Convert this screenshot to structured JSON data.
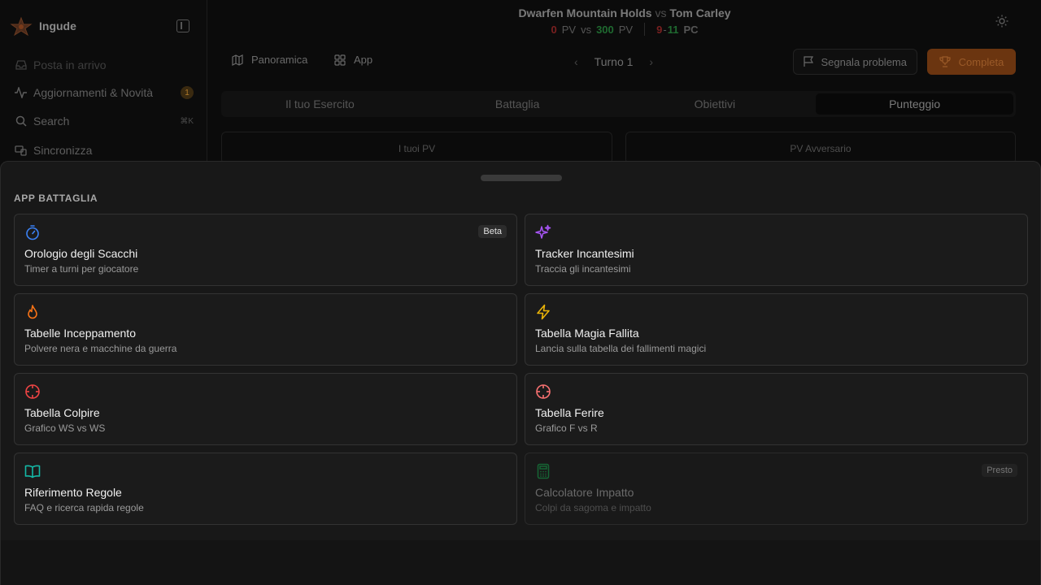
{
  "sidebar": {
    "brand_name": "Ingude",
    "items": [
      {
        "label": "Posta in arrivo",
        "icon": "inbox-icon"
      },
      {
        "label": "Aggiornamenti & Novità",
        "icon": "activity-icon",
        "badge": "1"
      },
      {
        "label": "Search",
        "icon": "search-icon",
        "shortcut": "⌘K"
      },
      {
        "label": "Sincronizza",
        "icon": "sync-icon"
      }
    ]
  },
  "header": {
    "player1": "Dwarfen Mountain Holds",
    "vs": "vs",
    "player2": "Tom Carley",
    "score": {
      "p1_pv": "0",
      "pv_label": "PV",
      "vs": "vs",
      "p2_pv": "300",
      "pc_left": "9",
      "pc_dash": "-",
      "pc_right": "11",
      "pc_label": "PC"
    }
  },
  "toolbar": {
    "overview_label": "Panoramica",
    "apps_label": "App",
    "turn_label": "Turno 1",
    "report_label": "Segnala problema",
    "complete_label": "Completa"
  },
  "tabs": [
    {
      "label": "Il tuo Esercito"
    },
    {
      "label": "Battaglia"
    },
    {
      "label": "Obiettivi"
    },
    {
      "label": "Punteggio",
      "active": true
    }
  ],
  "pv_boxes": {
    "mine": "I tuoi PV",
    "opponent": "PV Avversario"
  },
  "sheet": {
    "title": "APP BATTAGLIA",
    "cards": [
      {
        "title": "Orologio degli Scacchi",
        "desc": "Timer a turni per giocatore",
        "tag": "Beta",
        "icon": "stopwatch-icon",
        "color": "#3b82f6"
      },
      {
        "title": "Tracker Incantesimi",
        "desc": "Traccia gli incantesimi",
        "icon": "sparkles-icon",
        "color": "#a855f7"
      },
      {
        "title": "Tabelle Inceppamento",
        "desc": "Polvere nera e macchine da guerra",
        "icon": "flame-icon",
        "color": "#f97316"
      },
      {
        "title": "Tabella Magia Fallita",
        "desc": "Lancia sulla tabella dei fallimenti magici",
        "icon": "zap-icon",
        "color": "#eab308"
      },
      {
        "title": "Tabella Colpire",
        "desc": "Grafico WS vs WS",
        "icon": "crosshair-icon",
        "color": "#ef4444"
      },
      {
        "title": "Tabella Ferire",
        "desc": "Grafico F vs R",
        "icon": "crosshair-icon",
        "color": "#f87171"
      },
      {
        "title": "Riferimento Regole",
        "desc": "FAQ e ricerca rapida regole",
        "icon": "book-open-icon",
        "color": "#14b8a6"
      },
      {
        "title": "Calcolatore Impatto",
        "desc": "Colpi da sagoma e impatto",
        "tag": "Presto",
        "icon": "calculator-icon",
        "color": "#166534",
        "disabled": true
      }
    ]
  }
}
